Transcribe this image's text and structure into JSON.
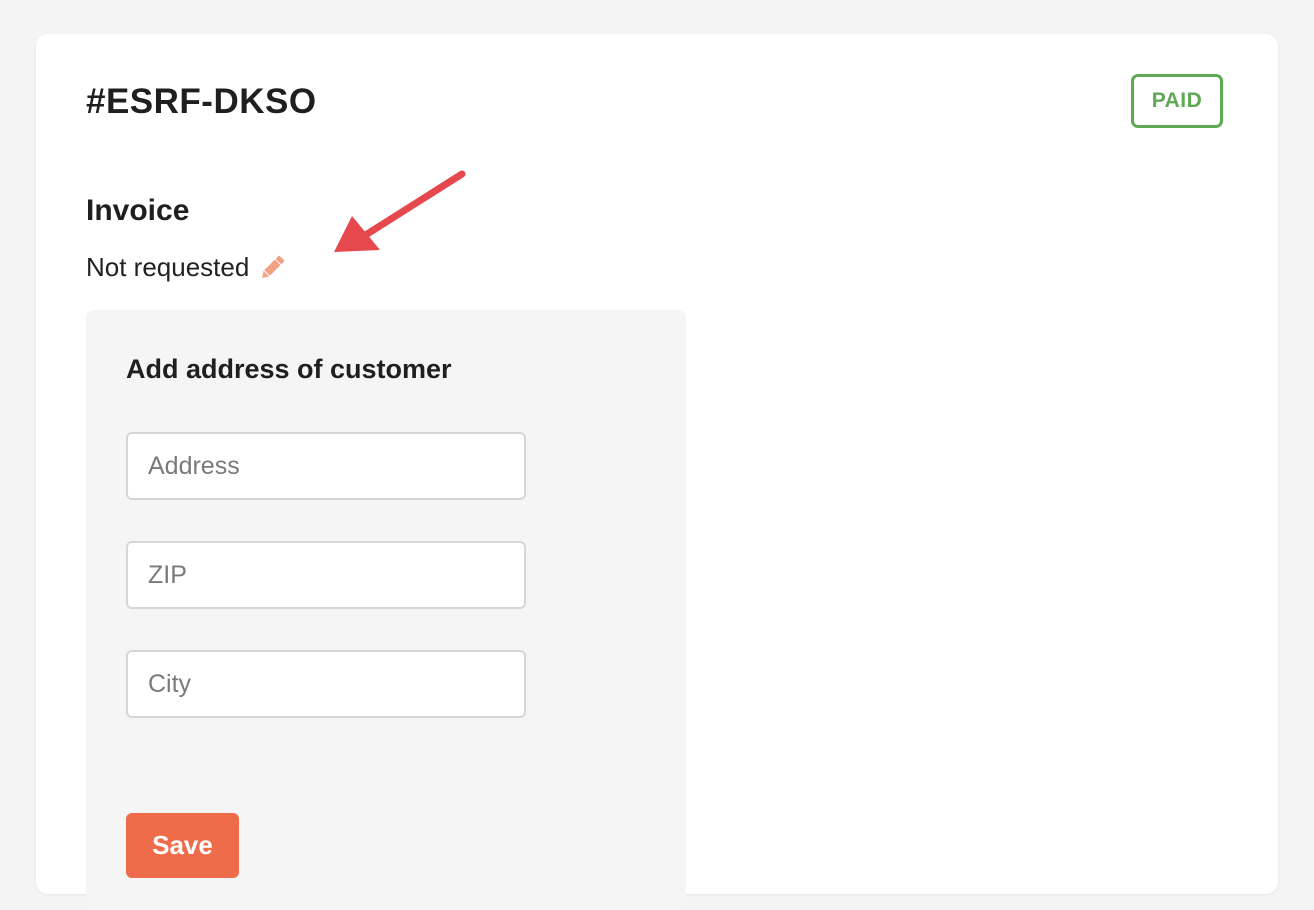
{
  "order": {
    "id": "#ESRF-DKSO",
    "status_badge": "PAID",
    "status_color": "#5fa955"
  },
  "invoice": {
    "title": "Invoice",
    "status_text": "Not requested",
    "edit_icon": "pencil-icon",
    "edit_icon_color": "#f2a183"
  },
  "annotation": {
    "icon": "arrow-icon",
    "color": "#e5484d"
  },
  "address_form": {
    "title": "Add address of customer",
    "fields": [
      {
        "name": "address",
        "placeholder": "Address",
        "value": ""
      },
      {
        "name": "zip",
        "placeholder": "ZIP",
        "value": ""
      },
      {
        "name": "city",
        "placeholder": "City",
        "value": ""
      }
    ],
    "save_label": "Save",
    "save_color": "#ef6c4a"
  }
}
